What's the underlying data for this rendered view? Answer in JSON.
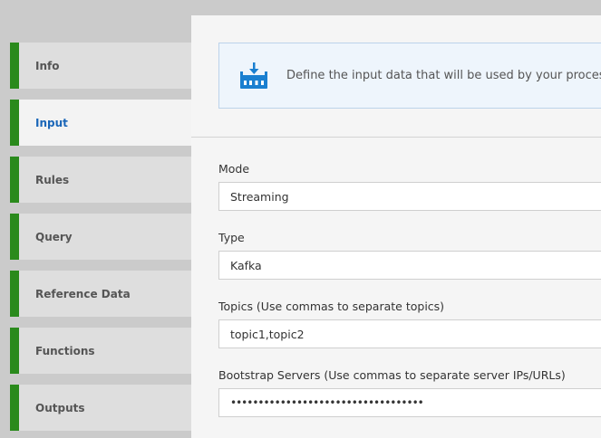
{
  "nav": {
    "items": [
      {
        "label": "Info",
        "active": false
      },
      {
        "label": "Input",
        "active": true
      },
      {
        "label": "Rules",
        "active": false
      },
      {
        "label": "Query",
        "active": false
      },
      {
        "label": "Reference Data",
        "active": false
      },
      {
        "label": "Functions",
        "active": false
      },
      {
        "label": "Outputs",
        "active": false
      }
    ]
  },
  "info": {
    "icon": "data-input-icon",
    "text": "Define the input data that will be used by your processing"
  },
  "form": {
    "mode": {
      "label": "Mode",
      "value": "Streaming"
    },
    "type": {
      "label": "Type",
      "value": "Kafka"
    },
    "topics": {
      "label": "Topics (Use commas to separate topics)",
      "value": "topic1,topic2"
    },
    "bootstrap": {
      "label": "Bootstrap Servers (Use commas to separate server IPs/URLs)",
      "value": "•••••••••••••••••••••••••••••••••••"
    }
  },
  "colors": {
    "accent_bar": "#2a8a1c",
    "active_label": "#1a66b8",
    "icon": "#1a7fd0"
  }
}
